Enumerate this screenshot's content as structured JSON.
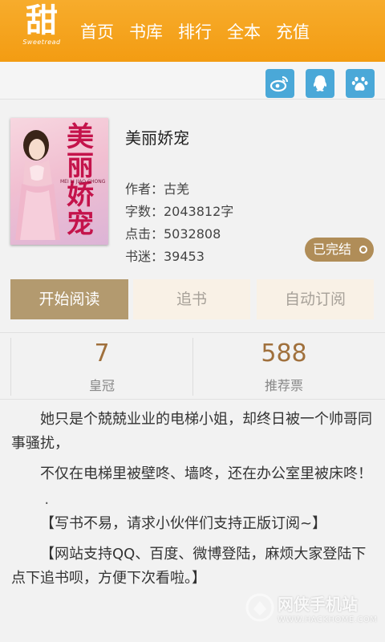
{
  "header": {
    "logo_text": "甜",
    "logo_sub": "Sweetread",
    "nav": [
      "首页",
      "书库",
      "排行",
      "全本",
      "充值"
    ]
  },
  "share": {
    "icons": [
      "weibo-icon",
      "qq-icon",
      "baidu-icon"
    ],
    "color": "#4aa8d8"
  },
  "book": {
    "cover_title": "美丽娇宠",
    "cover_pinyin": "MEI LI JIAO CHONG",
    "title": "美丽娇宠",
    "author": "作者：古羌",
    "words": "字数：2043812字",
    "clicks": "点击：5032808",
    "fans": "书迷：39453",
    "status": "已完结"
  },
  "actions": {
    "start_reading": "开始阅读",
    "follow": "追书",
    "auto_subscribe": "自动订阅"
  },
  "stats": [
    {
      "value": "7",
      "label": "皇冠"
    },
    {
      "value": "588",
      "label": "推荐票"
    }
  ],
  "description": [
    "她只是个兢兢业业的电梯小姐，却终日被一个帅哥同事骚扰，",
    "不仅在电梯里被壁咚、墙咚，还在办公室里被床咚！",
    ".",
    "【写书不易，请求小伙伴们支持正版订阅~】",
    "【网站支持QQ、百度、微博登陆，麻烦大家登陆下点下追书呗，方便下次看啦。】"
  ],
  "watermark": {
    "name": "网侠手机站",
    "url": "WWW.HACKHOME.COM"
  },
  "colors": {
    "header": "#f5a623",
    "primary_button": "#b39a6f",
    "badge": "#b08d58",
    "stat_value": "#a0703c"
  }
}
